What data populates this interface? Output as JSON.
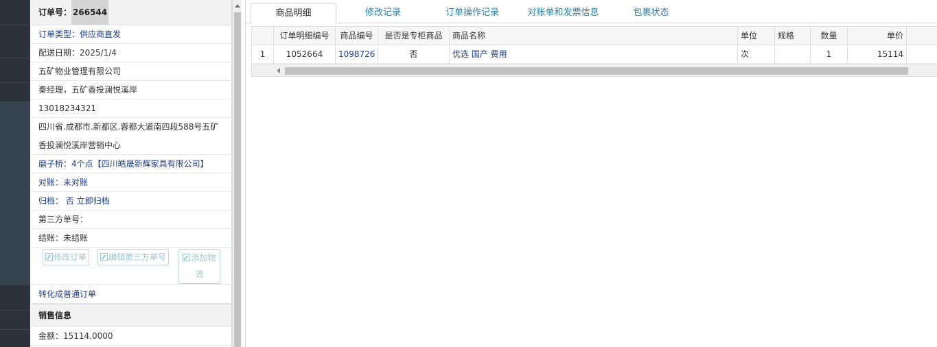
{
  "order_panel": {
    "order_no_label": "订单号：",
    "order_no": "266544",
    "order_type": "订单类型：供应商直发",
    "delivery_date": "配送日期：2025/1/4",
    "company": "五矿物业管理有限公司",
    "contact": "秦经理，五矿香投澜悦溪岸",
    "phone": "13018234321",
    "address": "四川省.成都市.新都区.蓉都大道南四段588号五矿香投澜悦溪岸营销中心",
    "supplier": "磨子桥：4个点【四川皓晟新辉家具有限公司】",
    "reconcile": "对账：未对账",
    "archive": "归档： 否 立即归档",
    "third_party_no": "第三方单号：",
    "settle": "结账：未结账",
    "buttons": {
      "edit_order": "修改订单",
      "edit_third_party": "编辑第三方单号",
      "add_logistics": "添加物流"
    },
    "convert_link": "转化成普通订单",
    "sales_header": "销售信息",
    "amount": "金额：15114.0000"
  },
  "tabs": [
    {
      "label": "商品明细",
      "active": true
    },
    {
      "label": "修改记录",
      "active": false
    },
    {
      "label": "订单操作记录",
      "active": false
    },
    {
      "label": "对账单和发票信息",
      "active": false
    },
    {
      "label": "包裹状态",
      "active": false
    }
  ],
  "grid": {
    "columns": [
      "",
      "订单明细编号",
      "商品编号",
      "是否是专柜商品",
      "商品名称",
      "单位",
      "规格",
      "数量",
      "单价"
    ],
    "rows": [
      [
        "1",
        "1052664",
        "1098726",
        "否",
        "优选 国产 费用",
        "次",
        "",
        "1",
        "15114"
      ]
    ]
  },
  "colors": {
    "link": "#1a3c8f",
    "tab_link": "#2f7fa8",
    "ghost_button": "#9cc7d4",
    "sidebar_dark": "#2b323b"
  }
}
